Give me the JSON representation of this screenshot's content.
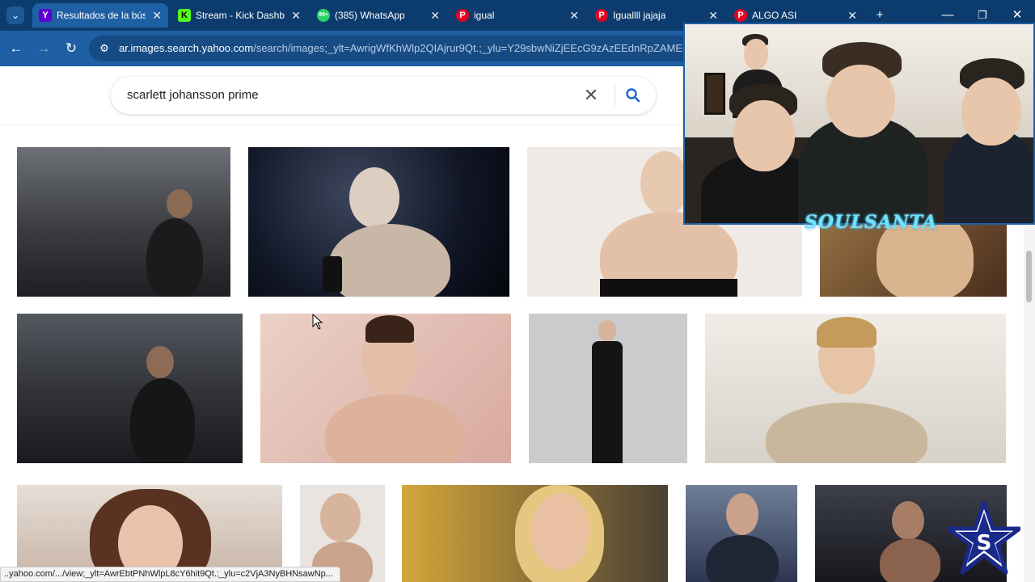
{
  "browser": {
    "tabs": [
      {
        "title": "Resultados de la búsq",
        "favicon": "Y",
        "favicon_color": "#6001d2",
        "active": true
      },
      {
        "title": "Stream - Kick Dashbo",
        "favicon": "K",
        "favicon_color": "#53fc18",
        "active": false
      },
      {
        "title": "(385) WhatsApp",
        "favicon": "99+",
        "favicon_color": "#25d366",
        "active": false
      },
      {
        "title": "igual",
        "favicon": "P",
        "favicon_color": "#e60023",
        "active": false
      },
      {
        "title": "Iguallll jajaja",
        "favicon": "P",
        "favicon_color": "#e60023",
        "active": false
      },
      {
        "title": "ALGO ASI",
        "favicon": "P",
        "favicon_color": "#e60023",
        "active": false
      }
    ],
    "tab_close_glyph": "✕",
    "new_tab_glyph": "+",
    "url_host": "ar.images.search.yahoo.com",
    "url_path": "/search/images;_ylt=AwrigWfKhWlp2QIAjrur9Qt.;_ylu=Y29sbwNiZjEEcG9zAzEEdnRpZAMEc2V",
    "status_url": "..yahoo.com/.../view;_ylt=AwrEbtPNhWlpL8cY6hit9Qt.;_ylu=c2VjA3NyBHNsawNp..."
  },
  "search": {
    "query": "scarlett johansson prime",
    "clear_glyph": "✕"
  },
  "overlay": {
    "channel_name": "SOULSANTA"
  },
  "colors": {
    "tabbar": "#0c3c6e",
    "toolbar": "#1f5fa3",
    "accent_search": "#1a66d6"
  }
}
